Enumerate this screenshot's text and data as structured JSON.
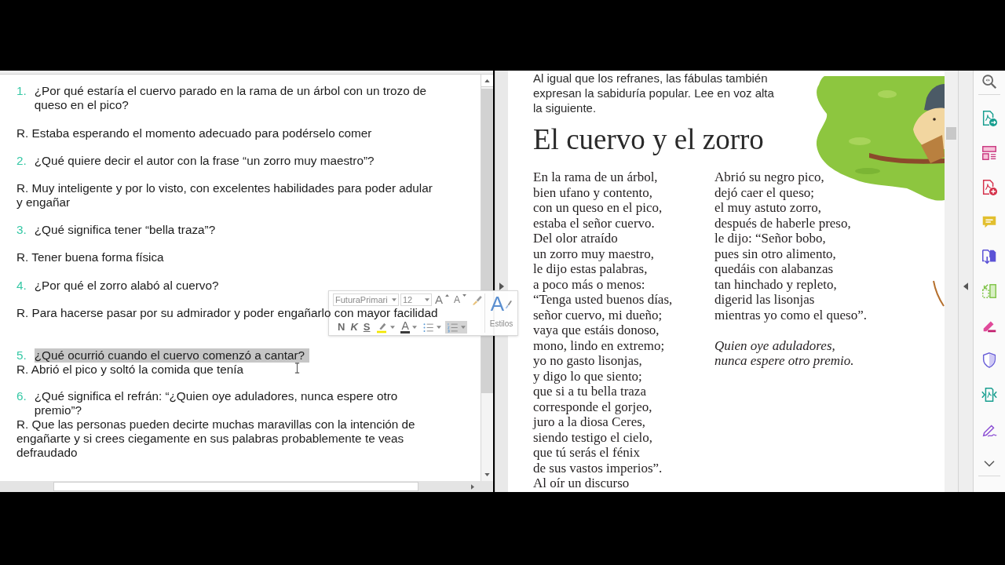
{
  "word_document": {
    "items": [
      {
        "kind": "question",
        "number": "1.",
        "text": "¿Por qué estaría el cuervo parado en la rama de un árbol con un trozo de\nqueso en el pico?",
        "selected": false
      },
      {
        "kind": "answer",
        "text": "R. Estaba esperando el momento adecuado para podérselo comer"
      },
      {
        "kind": "question",
        "number": "2.",
        "text": "¿Qué quiere decir el autor con la frase “un zorro muy maestro”?",
        "selected": false
      },
      {
        "kind": "answer",
        "text": "R. Muy inteligente y por lo visto, con excelentes habilidades para poder adular\ny engañar"
      },
      {
        "kind": "question",
        "number": "3.",
        "text": "¿Qué significa tener “bella traza”?",
        "selected": false
      },
      {
        "kind": "answer",
        "text": "R. Tener buena forma física"
      },
      {
        "kind": "question",
        "number": "4.",
        "text": "¿Por qué el zorro alabó al cuervo?",
        "selected": false
      },
      {
        "kind": "answer",
        "text": "R. Para hacerse pasar por su admirador y poder engañarlo con mayor facilidad"
      },
      {
        "kind": "question",
        "number": "5.",
        "text": "¿Qué ocurrió cuando el cuervo comenzó a cantar?",
        "selected": true
      },
      {
        "kind": "answer",
        "text": "R. Abrió el pico y soltó la comida que tenía"
      },
      {
        "kind": "question",
        "number": "6.",
        "text": "¿Qué significa el refrán: “¿Quien oye aduladores, nunca espere otro\npremio”?",
        "selected": false
      },
      {
        "kind": "answer",
        "text": "R. Que las personas pueden decirte muchas maravillas con la intención de\nengañarte y si crees ciegamente en sus palabras probablemente te veas\ndefraudado"
      }
    ]
  },
  "mini_toolbar": {
    "font": "FuturaPrimari",
    "size": "12",
    "buttons": [
      {
        "kind": "grow_font",
        "label": "A",
        "on": false
      },
      {
        "kind": "shrink_font",
        "label": "A",
        "on": false
      },
      {
        "kind": "format_painter",
        "on": false
      },
      {
        "kind": "bold",
        "label": "N",
        "on": false
      },
      {
        "kind": "italic",
        "label": "K",
        "on": false
      },
      {
        "kind": "underline",
        "label": "S",
        "on": false
      },
      {
        "kind": "highlight",
        "on": false
      },
      {
        "kind": "font_color",
        "label": "A",
        "on": false
      },
      {
        "kind": "bullets",
        "on": false
      },
      {
        "kind": "numbering",
        "on": true
      }
    ],
    "styles": {
      "glyph": "A",
      "label": "Estilos"
    }
  },
  "pdf_page": {
    "intro": "Al igual que los refranes, las fábulas también\nexpresan la sabiduría popular. Lee en voz alta\nla siguiente.",
    "title": "El cuervo y el zorro",
    "columns": [
      [
        "En la rama de un árbol,",
        "bien ufano y contento,",
        "con un queso en el pico,",
        "estaba el señor cuervo.",
        "Del olor atraído",
        "un zorro muy maestro,",
        "le dijo estas palabras,",
        "a poco más o menos:",
        "“Tenga usted buenos días,",
        "señor cuervo, mi dueño;",
        "vaya que estáis donoso,",
        "mono, lindo en extremo;",
        "yo no gasto lisonjas,",
        "y digo lo que siento;",
        "que si a tu bella traza",
        "corresponde el gorjeo,",
        "juro a la diosa Ceres,",
        "siendo testigo el cielo,",
        "que tú serás el fénix",
        "de sus vastos imperios”.",
        "Al oír un discurso"
      ],
      [
        "Abrió su negro pico,",
        "dejó caer el queso;",
        "el muy astuto zorro,",
        "después de haberle preso,",
        "le dijo: “Señor bobo,",
        "pues sin otro alimento,",
        "quedáis con alabanzas",
        "tan hinchado y repleto,",
        "digerid las lisonjas",
        "mientras yo como el queso”."
      ]
    ],
    "moral": [
      "Quien oye aduladores,",
      "nunca espere otro premio."
    ]
  }
}
